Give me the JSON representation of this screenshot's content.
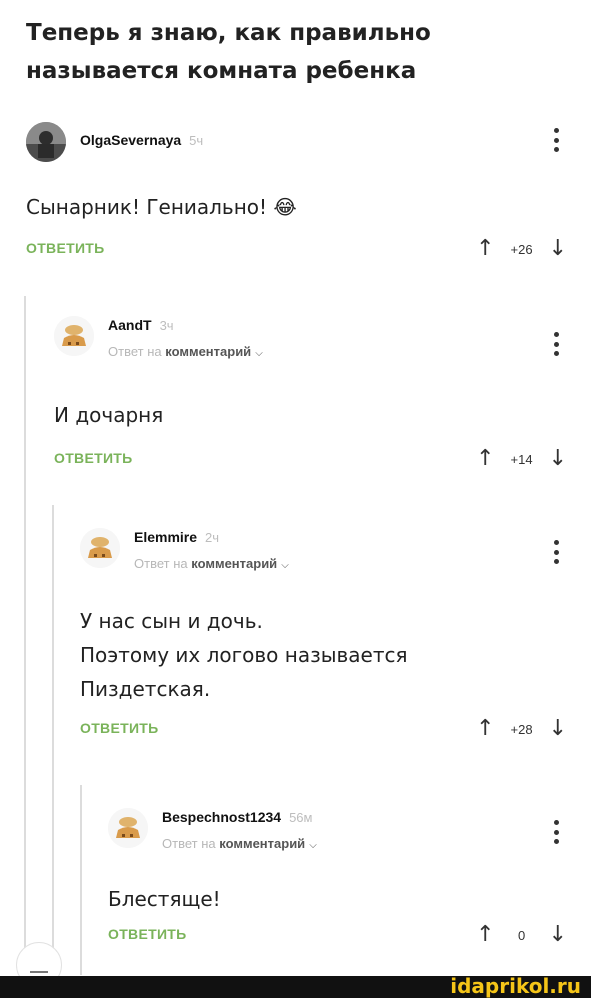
{
  "post": {
    "title": "Теперь я знаю, как правильно называется комната ребенка"
  },
  "comments": [
    {
      "username": "OlgaSevernaya",
      "time": "5ч",
      "reply_to": null,
      "text": "Сынарник! Гениально! 😂",
      "reply_label": "ОТВЕТИТЬ",
      "score": "+26",
      "avatar": "photo-avatar"
    },
    {
      "username": "AandT",
      "time": "3ч",
      "reply_to": {
        "prefix": "Ответ на",
        "link": "комментарий"
      },
      "text": "И дочарня",
      "reply_label": "ОТВЕТИТЬ",
      "score": "+14",
      "avatar": "bread-avatar"
    },
    {
      "username": "Elemmire",
      "time": "2ч",
      "reply_to": {
        "prefix": "Ответ на",
        "link": "комментарий"
      },
      "text": "У нас сын и дочь.\nПоэтому их логово называется\nПиздетская.",
      "reply_label": "ОТВЕТИТЬ",
      "score": "+28",
      "avatar": "bread-avatar"
    },
    {
      "username": "Bespechnost1234",
      "time": "56м",
      "reply_to": {
        "prefix": "Ответ на",
        "link": "комментарий"
      },
      "text": "Блестяще!",
      "reply_label": "ОТВЕТИТЬ",
      "score": "0",
      "avatar": "bread-avatar"
    }
  ],
  "icons": {
    "upvote": "↑",
    "downvote": "↓",
    "more": "more-vertical-icon",
    "collapse": "minus-icon"
  },
  "colors": {
    "reply_green": "#7ab35a",
    "watermark": "#f5c518"
  },
  "watermark": {
    "text": "idaprikol.ru"
  }
}
